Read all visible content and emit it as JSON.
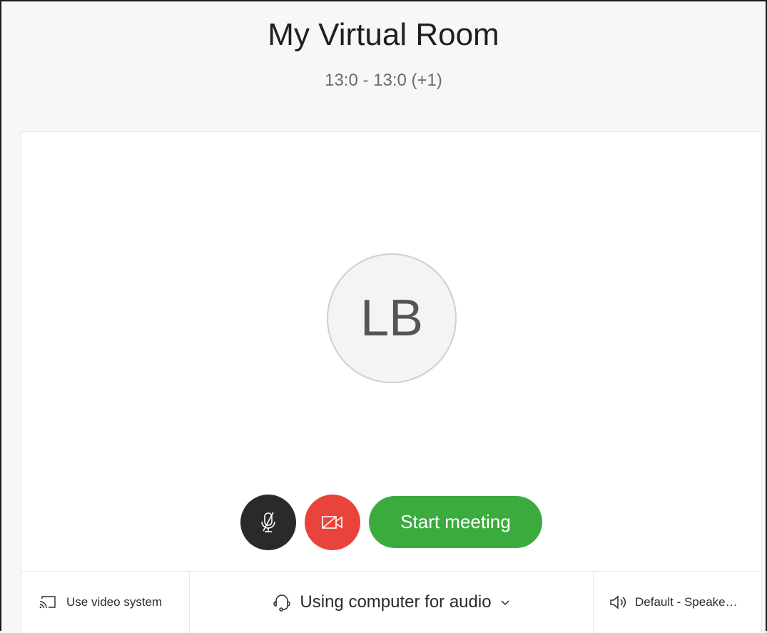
{
  "header": {
    "title": "My Virtual Room",
    "time": "13:0 - 13:0 (+1)"
  },
  "preview": {
    "avatar_initials": "LB"
  },
  "controls": {
    "mute_icon": "microphone-muted-icon",
    "video_icon": "video-off-icon",
    "start_label": "Start meeting"
  },
  "bottom_bar": {
    "video_system_label": "Use video system",
    "audio_label": "Using computer for audio",
    "speaker_label": "Default - Speake…"
  },
  "colors": {
    "mute_bg": "#2a2a2a",
    "video_off_bg": "#e8443b",
    "start_bg": "#3bab3e"
  }
}
